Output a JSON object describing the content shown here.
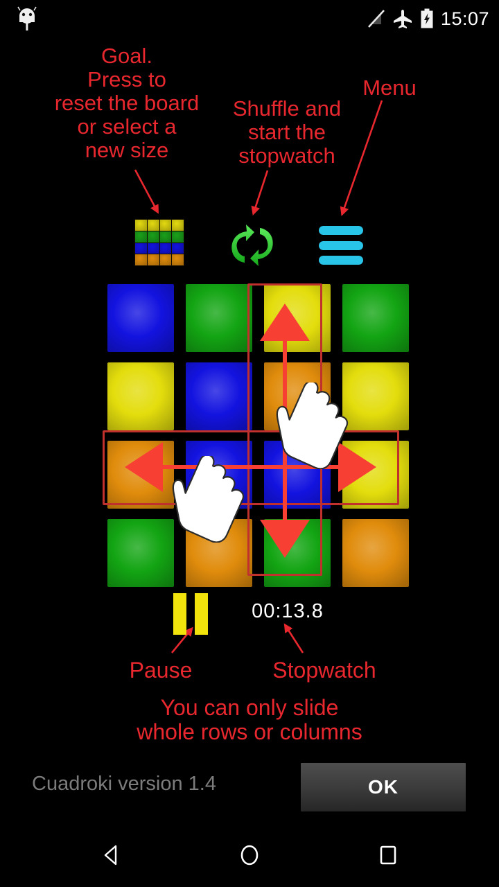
{
  "status_bar": {
    "icons": [
      "android-head-icon",
      "signal-off-icon",
      "airplane-mode-icon",
      "battery-charging-icon"
    ],
    "clock": "15:07"
  },
  "annotations": {
    "goal": "Goal.\nPress to\nreset the board\nor select a\nnew size",
    "shuffle": "Shuffle and\nstart the\nstopwatch",
    "menu": "Menu",
    "pause": "Pause",
    "stopwatch": "Stopwatch",
    "rule": "You can only slide\nwhole rows or columns",
    "color": "#e8282e"
  },
  "toolbar": {
    "goal_icon": {
      "name": "goal-grid-icon",
      "rows": 4,
      "cols": 4,
      "row_colors": [
        "#e3d910",
        "#1aa01a",
        "#1313e0",
        "#e08c0c"
      ]
    },
    "shuffle_icon": {
      "name": "shuffle-icon",
      "color": "#35d13a"
    },
    "menu_icon": {
      "name": "menu-hamburger-icon",
      "color": "#29c5e8",
      "bars": 3
    }
  },
  "board": {
    "rows": 4,
    "cols": 4,
    "tiles": [
      [
        "blue",
        "green",
        "yellow",
        "green"
      ],
      [
        "yellow",
        "blue",
        "orange",
        "yellow"
      ],
      [
        "orange",
        "blue",
        "blue",
        "yellow"
      ],
      [
        "green",
        "orange",
        "green",
        "orange"
      ]
    ],
    "palette": {
      "blue": "#1313e0",
      "green": "#13a513",
      "yellow": "#e3dd0d",
      "orange": "#e08c0c"
    },
    "highlight_color": "#c0302d",
    "highlighted_column": 3,
    "highlighted_row": 3,
    "arrows": [
      "up",
      "down",
      "left",
      "right"
    ],
    "arrow_color": "#f73f33",
    "hands": [
      "hand-cursor-column",
      "hand-cursor-row"
    ]
  },
  "controls": {
    "pause": {
      "name": "pause-icon",
      "color": "#f2e30d"
    },
    "stopwatch_value": "00:13.8"
  },
  "footer": {
    "version": "Cuadroki version 1.4",
    "ok_label": "OK"
  },
  "navbar": {
    "back": "back-icon",
    "home": "home-icon",
    "recents": "recents-icon"
  }
}
